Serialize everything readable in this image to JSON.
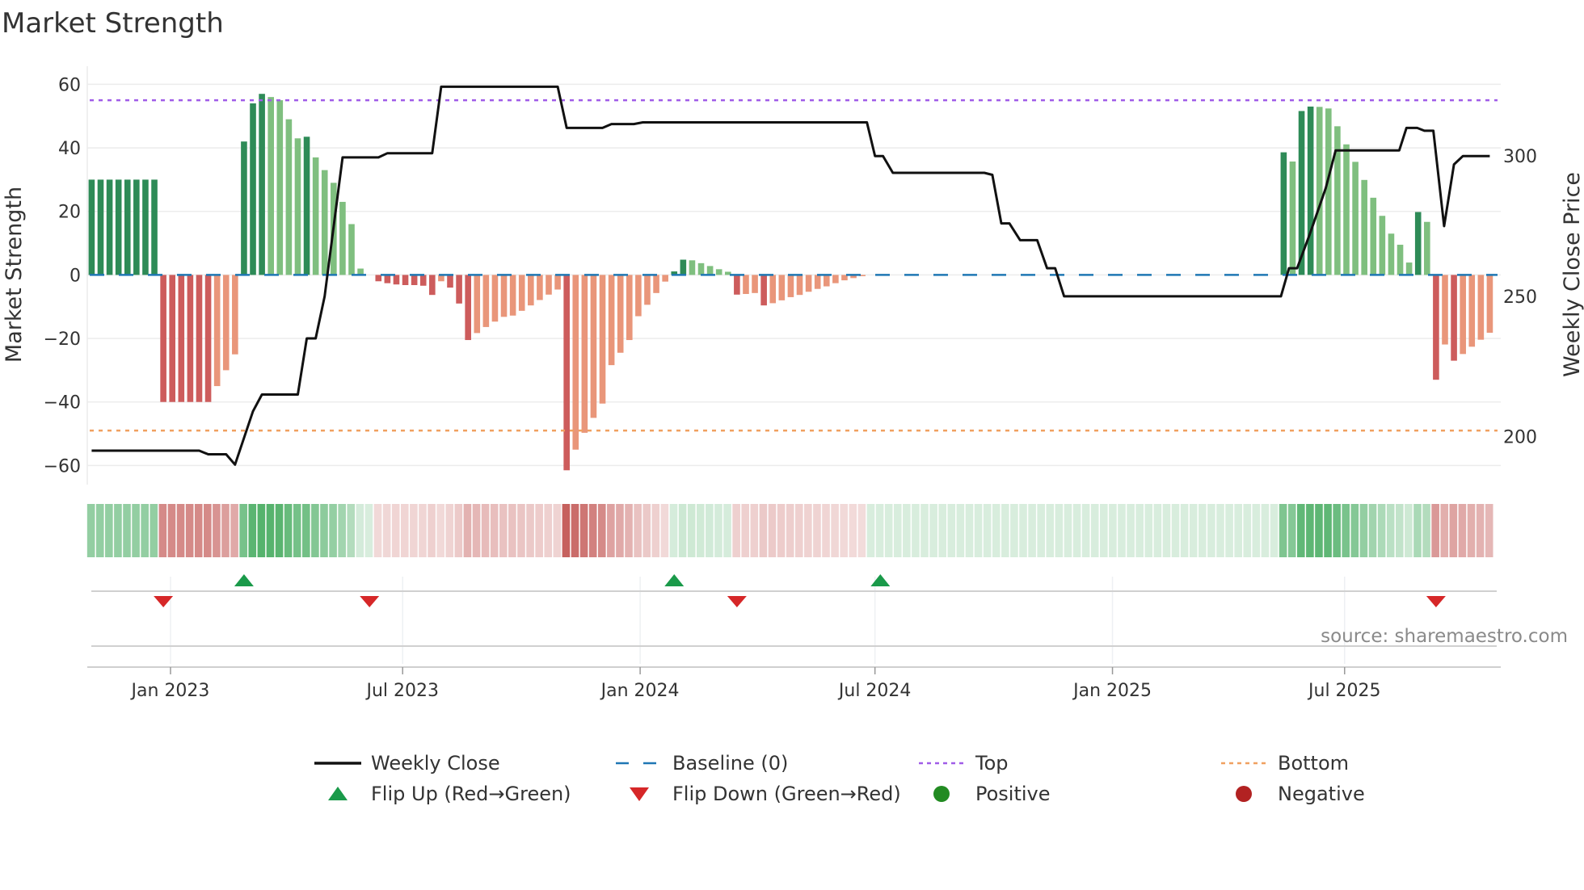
{
  "chart_data": {
    "type": "bar",
    "title": "Market Strength",
    "ylabel": "Market Strength",
    "y2label": "Weekly Close Price",
    "source": "source: sharemaestro.com",
    "ylim": [
      -66,
      65.7
    ],
    "y2lim": [
      182.9,
      332
    ],
    "yticks": [
      60,
      40,
      20,
      0,
      -20,
      -40,
      -60
    ],
    "ytick_labels": [
      "60",
      "40",
      "20",
      "0",
      "−20",
      "−40",
      "−60"
    ],
    "y2ticks": [
      300,
      250,
      200
    ],
    "y2tick_labels": [
      "300",
      "250",
      "200"
    ],
    "x_unit": "week index (weekly bars, first bar ~early Nov 2022)",
    "xticks": [
      {
        "label": "Jan 2023",
        "week": 8.8
      },
      {
        "label": "Jul 2023",
        "week": 34.7
      },
      {
        "label": "Jan 2024",
        "week": 61.2
      },
      {
        "label": "Jul 2024",
        "week": 87.4
      },
      {
        "label": "Jan 2025",
        "week": 113.9
      },
      {
        "label": "Jul 2025",
        "week": 139.8
      }
    ],
    "top_level": 55,
    "bottom_level": -49,
    "baseline": 0,
    "grid": true,
    "strength": [
      30,
      30,
      30,
      30,
      30,
      30,
      30,
      30,
      -40,
      -40,
      -40,
      -40,
      -40,
      -40,
      -35,
      -30,
      -25,
      42,
      54,
      57,
      56,
      55,
      49,
      43,
      43.5,
      37,
      33,
      29,
      23,
      16,
      2,
      0,
      -2,
      -2.6,
      -3,
      -3.2,
      -3.2,
      -3.4,
      -6.3,
      -2,
      -4,
      -9,
      -20.5,
      -18.3,
      -16.4,
      -14.7,
      -13.2,
      -12.8,
      -11.3,
      -9.6,
      -7.9,
      -6.2,
      -4.6,
      -61.5,
      -55,
      -49.7,
      -45,
      -40.5,
      -28.4,
      -24.5,
      -20.5,
      -13,
      -9.4,
      -5.7,
      -2.1,
      1.1,
      4.8,
      4.6,
      3.7,
      2.8,
      1.8,
      1,
      -6.2,
      -6,
      -5.7,
      -9.6,
      -8.9,
      -8,
      -7,
      -6.3,
      -5.3,
      -4.4,
      -3.6,
      -2.6,
      -1.7,
      -1,
      -0.4,
      0,
      0,
      0,
      0,
      0,
      0,
      0,
      0,
      0,
      0,
      0,
      0,
      0,
      0,
      0,
      0,
      0,
      0,
      0,
      0,
      0,
      0,
      0,
      0,
      0,
      0,
      0,
      0,
      0,
      0,
      0,
      0,
      0,
      0,
      0,
      0,
      0,
      0,
      0,
      0,
      0,
      0,
      0,
      0,
      0,
      0,
      38.6,
      35.7,
      51.6,
      53,
      52.9,
      52.4,
      46.8,
      41.1,
      35.6,
      29.9,
      24.3,
      18.6,
      13,
      9.5,
      3.9,
      19.8,
      16.7,
      -33,
      -21.9,
      -27,
      -24.9,
      -22.6,
      -20.4,
      -18.2
    ],
    "weekly_close": [
      [
        0,
        195
      ],
      [
        12,
        195
      ],
      [
        13,
        193.7
      ],
      [
        15,
        193.7
      ],
      [
        16,
        190
      ],
      [
        18,
        209
      ],
      [
        19,
        215
      ],
      [
        23,
        215
      ],
      [
        24,
        235
      ],
      [
        25,
        235
      ],
      [
        26,
        250
      ],
      [
        28,
        299.5
      ],
      [
        32,
        299.5
      ],
      [
        33,
        301
      ],
      [
        38,
        301
      ],
      [
        39,
        324.7
      ],
      [
        52,
        324.7
      ],
      [
        53,
        310
      ],
      [
        57,
        310
      ],
      [
        58,
        311.4
      ],
      [
        60.5,
        311.4
      ],
      [
        61.5,
        312
      ],
      [
        86.5,
        312
      ],
      [
        87.4,
        300
      ],
      [
        88.3,
        300
      ],
      [
        89.4,
        294
      ],
      [
        99.6,
        294
      ],
      [
        100.5,
        293.3
      ],
      [
        101.5,
        276
      ],
      [
        102.4,
        276
      ],
      [
        103.6,
        270
      ],
      [
        105.5,
        270
      ],
      [
        106.6,
        260
      ],
      [
        107.5,
        260
      ],
      [
        108.5,
        250
      ],
      [
        132.7,
        250
      ],
      [
        133.6,
        260
      ],
      [
        134.5,
        260
      ],
      [
        135.9,
        272
      ],
      [
        137.7,
        288.6
      ],
      [
        138.8,
        302
      ],
      [
        145.9,
        302
      ],
      [
        146.7,
        310
      ],
      [
        147.9,
        310
      ],
      [
        148.7,
        309
      ],
      [
        149.7,
        309
      ],
      [
        150.9,
        275
      ],
      [
        152,
        297
      ],
      [
        153,
        300
      ],
      [
        156,
        300
      ]
    ],
    "flip_up_weeks": [
      17,
      65,
      88
    ],
    "flip_down_weeks": [
      8,
      31,
      72,
      150
    ],
    "legend": [
      {
        "label": "Weekly Close",
        "kind": "line"
      },
      {
        "label": "Baseline (0)",
        "kind": "dash"
      },
      {
        "label": "Top",
        "kind": "dotted-top"
      },
      {
        "label": "Bottom",
        "kind": "dotted-bottom"
      },
      {
        "label": "Flip Up (Red→Green)",
        "kind": "up"
      },
      {
        "label": "Flip Down (Green→Red)",
        "kind": "down"
      },
      {
        "label": "Positive",
        "kind": "pos"
      },
      {
        "label": "Negative",
        "kind": "neg"
      }
    ],
    "legend_position": "bottom-center",
    "colors": {
      "strong_green": "#2e8b57",
      "weak_green": "#7fbf7f",
      "strong_red": "#cd5c5c",
      "weak_red": "#e9967a",
      "baseline": "#1f77b4",
      "top": "#a05ce8",
      "bottom": "#f0a060",
      "price": "#111111",
      "flip_up": "#1a9a4a",
      "flip_down": "#d62728",
      "positive": "#228b22",
      "negative": "#b22222",
      "strip_green": "#3aa655",
      "strip_red": "#c0504d"
    }
  }
}
